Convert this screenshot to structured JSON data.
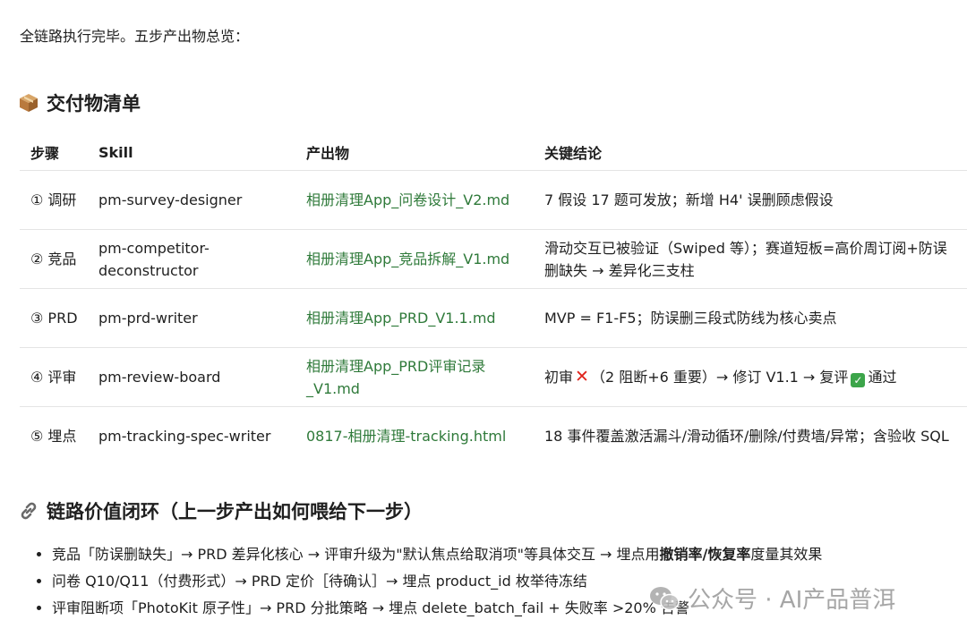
{
  "intro": "全链路执行完毕。五步产出物总览：",
  "deliverables": {
    "heading": "交付物清单",
    "icon": "package-icon",
    "columns": [
      "步骤",
      "Skill",
      "产出物",
      "关键结论"
    ],
    "rows": [
      {
        "step": "① 调研",
        "skill": "pm-survey-designer",
        "output": "相册清理App_问卷设计_V2.md",
        "conclusion": "7 假设 17 题可发放；新增 H4' 误删顾虑假设"
      },
      {
        "step": "② 竞品",
        "skill": "pm-competitor-deconstructor",
        "output": "相册清理App_竞品拆解_V1.md",
        "conclusion": "滑动交互已被验证（Swiped 等）；赛道短板=高价周订阅+防误删缺失 → 差异化三支柱"
      },
      {
        "step": "③ PRD",
        "skill": "pm-prd-writer",
        "output": "相册清理App_PRD_V1.1.md",
        "conclusion": "MVP = F1-F5；防误删三段式防线为核心卖点"
      },
      {
        "step": "④ 评审",
        "skill": "pm-review-board",
        "output": "相册清理App_PRD评审记录_V1.md",
        "conclusion_a": "初审",
        "conclusion_b": "（2 阻断+6 重要）→ 修订 V1.1 → 复评",
        "conclusion_c": "通过"
      },
      {
        "step": "⑤ 埋点",
        "skill": "pm-tracking-spec-writer",
        "output": "0817-相册清理-tracking.html",
        "conclusion": "18 事件覆盖激活漏斗/滑动循环/删除/付费墙/异常；含验收 SQL"
      }
    ]
  },
  "chain": {
    "heading": "链路价值闭环（上一步产出如何喂给下一步）",
    "icon": "link-icon",
    "items": [
      {
        "a": "竞品「防误删缺失」→ PRD 差异化核心 → 评审升级为\"默认焦点给取消项\"等具体交互 → 埋点用",
        "bold": "撤销率/恢复率",
        "b": "度量其效果"
      },
      {
        "a": "问卷 Q10/Q11（付费形式）→ PRD 定价［待确认］→ 埋点 product_id 枚举待冻结"
      },
      {
        "a": "评审阻断项「PhotoKit 原子性」→ PRD 分批策略 → 埋点 delete_batch_fail + 失败率 >20% 告警"
      }
    ]
  },
  "watermark": {
    "icon": "wechat-icon",
    "text": "公众号 · AI产品普洱"
  }
}
